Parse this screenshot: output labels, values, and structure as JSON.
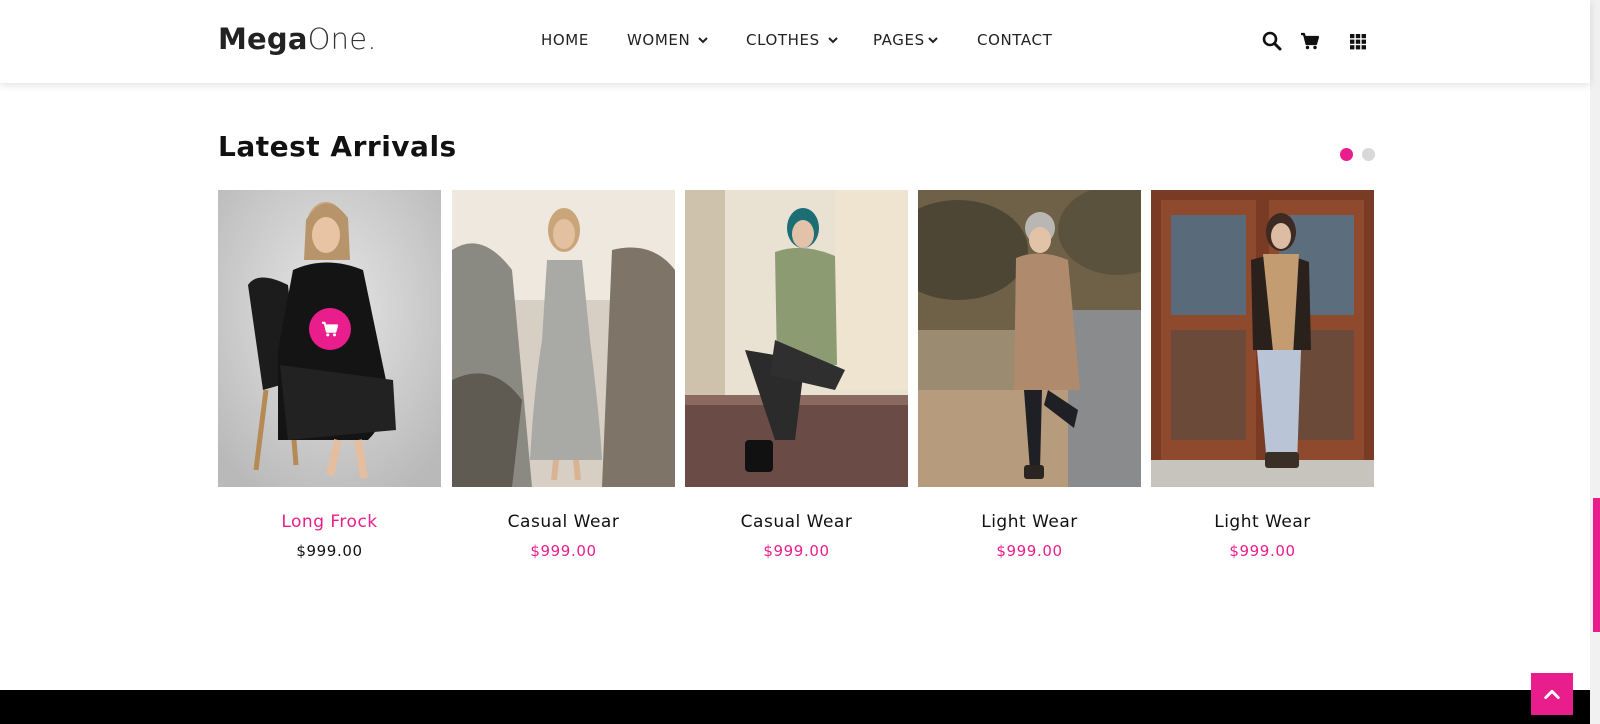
{
  "brand": {
    "name_bold": "Mega",
    "name_light": "One."
  },
  "nav": [
    {
      "label": "HOME",
      "dropdown": false
    },
    {
      "label": "WOMEN",
      "dropdown": true
    },
    {
      "label": "CLOTHES",
      "dropdown": true
    },
    {
      "label": "PAGES",
      "dropdown": true
    },
    {
      "label": "CONTACT",
      "dropdown": false
    }
  ],
  "header_icons": [
    "search-icon",
    "cart-icon",
    "grid-menu-icon"
  ],
  "section": {
    "title": "Latest Arrivals"
  },
  "carousel": {
    "pages": 2,
    "active_page": 1
  },
  "products": [
    {
      "name": "Long Frock",
      "price": "$999.00",
      "highlighted": true,
      "image": "woman in black turtleneck sitting on black chair"
    },
    {
      "name": "Casual Wear",
      "price": "$999.00",
      "highlighted": false,
      "image": "woman in light grey sundress among shrubs"
    },
    {
      "name": "Casual Wear",
      "price": "$999.00",
      "highlighted": false,
      "image": "woman in green fleece jacket and sunglasses"
    },
    {
      "name": "Light Wear",
      "price": "$999.00",
      "highlighted": false,
      "image": "woman in camel coat and beanie outdoors"
    },
    {
      "name": "Light Wear",
      "price": "$999.00",
      "highlighted": false,
      "image": "woman with plaid scarf by wooden door"
    }
  ],
  "colors": {
    "accent": "#e91e8c",
    "text": "#111111",
    "footer": "#000000",
    "dot_inactive": "#d8d8d8"
  }
}
